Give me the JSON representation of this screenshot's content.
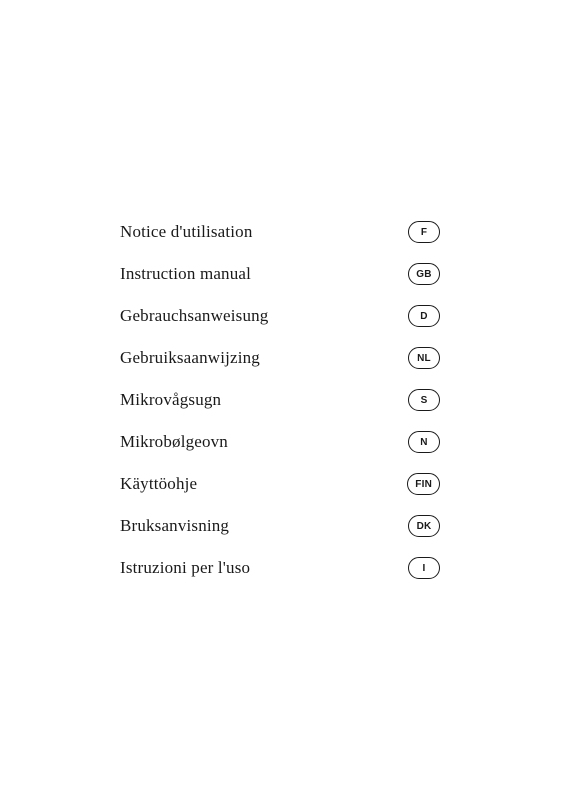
{
  "page": {
    "background": "#ffffff"
  },
  "items": [
    {
      "label": "Notice d'utilisation",
      "badge": "F"
    },
    {
      "label": "Instruction manual",
      "badge": "GB"
    },
    {
      "label": "Gebrauchsanweisung",
      "badge": "D"
    },
    {
      "label": "Gebruiksaanwijzing",
      "badge": "NL"
    },
    {
      "label": "Mikrovågsugn",
      "badge": "S"
    },
    {
      "label": "Mikrobølgeovn",
      "badge": "N"
    },
    {
      "label": "Käyttöohje",
      "badge": "FIN"
    },
    {
      "label": "Bruksanvisning",
      "badge": "DK"
    },
    {
      "label": "Istruzioni per l'uso",
      "badge": "I"
    }
  ]
}
